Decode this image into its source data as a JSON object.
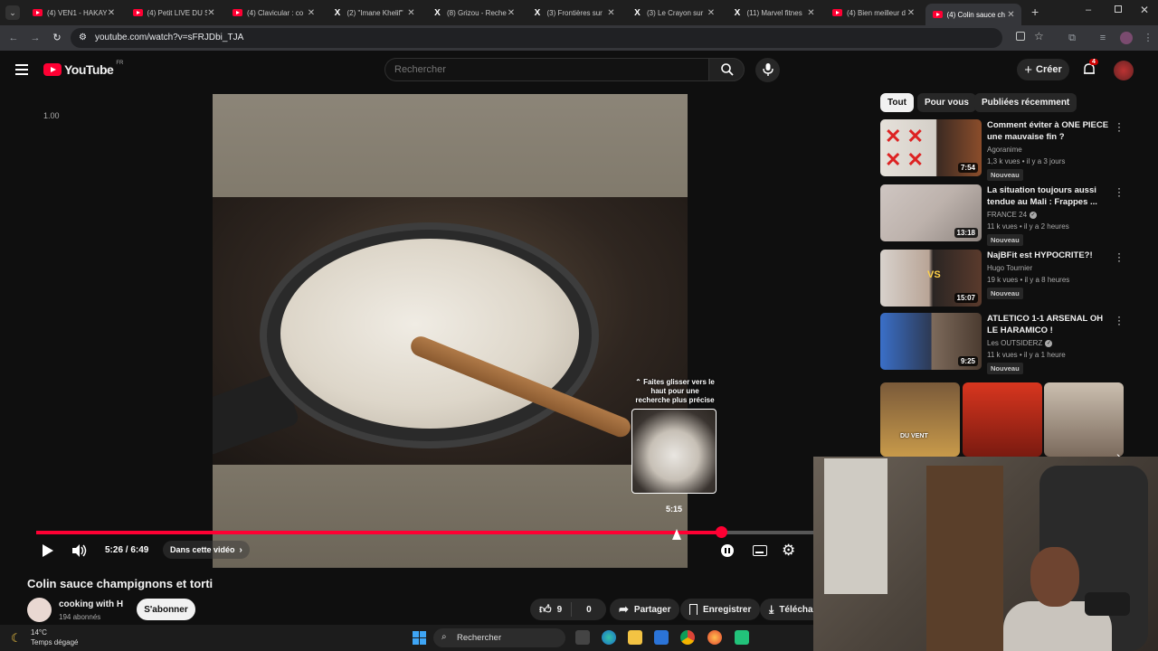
{
  "browser": {
    "tabs": [
      {
        "title": "(4) VEN1 - HAKAY",
        "type": "youtube"
      },
      {
        "title": "(4) Petit LIVE DU S",
        "type": "youtube"
      },
      {
        "title": "(4) Clavicular : co",
        "type": "youtube"
      },
      {
        "title": "(2) \"Imane Khelif\"",
        "type": "x"
      },
      {
        "title": "(8) Grizou - Reche",
        "type": "x"
      },
      {
        "title": "(3) Frontières sur",
        "type": "x"
      },
      {
        "title": "(3) Le Crayon sur",
        "type": "x"
      },
      {
        "title": "(11) Marvel fitnes",
        "type": "x"
      },
      {
        "title": "(4) Bien meilleur d",
        "type": "youtube"
      },
      {
        "title": "(4) Colin sauce ch",
        "type": "youtube",
        "active": true
      }
    ],
    "url": "youtube.com/watch?v=sFRJDbi_TJA"
  },
  "header": {
    "logo": "YouTube",
    "region": "FR",
    "search_placeholder": "Rechercher",
    "create_label": "Créer",
    "notifications": "4"
  },
  "player": {
    "speed_label": "1.00",
    "seek_hint": "⌃ Faites glisser vers le haut pour une recherche plus précise",
    "preview_time": "5:15",
    "time": "5:26 / 6:49",
    "progress": 0.88,
    "chapter_label": "Dans cette vidéo",
    "accent_color": "#ff0033"
  },
  "video": {
    "title": "Colin sauce champignons et torti",
    "channel": "cooking with H",
    "subscribers": "194 abonnés",
    "subscribe_label": "S'abonner",
    "likes": "9",
    "dislikes": "0",
    "share_label": "Partager",
    "save_label": "Enregistrer",
    "download_label": "Téléchar"
  },
  "sidebar": {
    "chips": [
      "Tout",
      "Pour vous",
      "Publiées récemment"
    ],
    "recommendations": [
      {
        "title": "Comment éviter à ONE PIECE une mauvaise fin ?",
        "channel": "Agoranime",
        "meta": "1,3 k vues • il y a 3 jours",
        "badge": "Nouveau",
        "duration": "7:54",
        "verified": false
      },
      {
        "title": "La situation toujours aussi tendue au Mali : Frappes ...",
        "channel": "FRANCE 24",
        "meta": "11 k vues • il y a 2 heures",
        "badge": "Nouveau",
        "duration": "13:18",
        "verified": true
      },
      {
        "title": "NajBFit est HYPOCRITE?!",
        "channel": "Hugo Tournier",
        "meta": "19 k vues • il y a 8 heures",
        "badge": "Nouveau",
        "duration": "15:07",
        "verified": false
      },
      {
        "title": "ATLETICO 1-1 ARSENAL OH LE HARAMICO !",
        "channel": "Les OUTSIDERZ",
        "meta": "11 k vues • il y a 1 heure",
        "badge": "Nouveau",
        "duration": "9:25",
        "verified": true
      }
    ],
    "short_labels": [
      "DU VENT"
    ]
  },
  "taskbar": {
    "temperature": "14°C",
    "weather": "Temps dégagé",
    "search_label": "Rechercher"
  }
}
